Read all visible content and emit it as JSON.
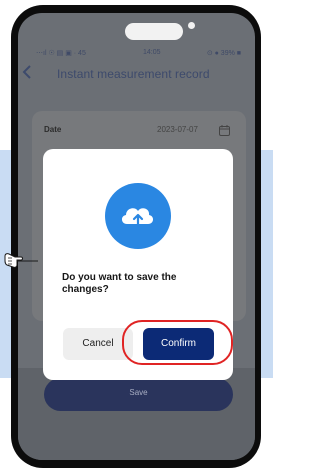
{
  "status_bar": {
    "left": "⋯ıl ☉ ▤ ▣ · 45",
    "time": "14:05",
    "right": "⊙ ● 39% ■"
  },
  "header": {
    "title": "Instant measurement record"
  },
  "form": {
    "date_label": "Date",
    "date_value": "2023-07-07"
  },
  "save_button": {
    "label": "Save"
  },
  "dialog": {
    "message": "Do you want to save the changes?",
    "cancel_label": "Cancel",
    "confirm_label": "Confirm",
    "icon": "cloud-upload-icon"
  },
  "colors": {
    "accent": "#0c2a76",
    "icon_bg": "#2a87e2",
    "highlight": "#e02424",
    "band": "#c9dcf3"
  }
}
